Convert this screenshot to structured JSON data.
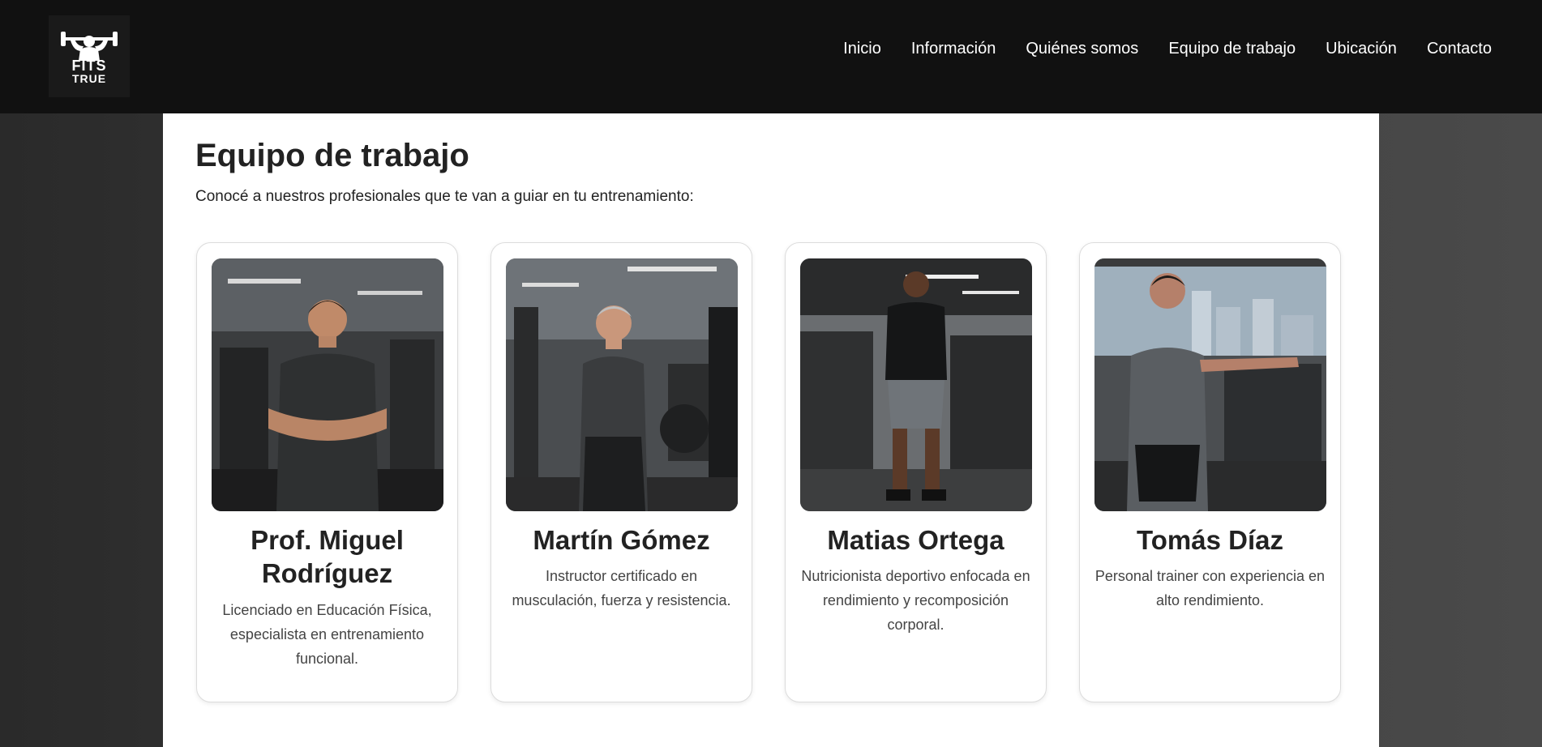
{
  "brand": {
    "line1": "FITS",
    "line2": "TRUE",
    "icon": "bodybuilder-dumbbell-logo"
  },
  "nav": [
    "Inicio",
    "Información",
    "Quiénes somos",
    "Equipo de trabajo",
    "Ubicación",
    "Contacto"
  ],
  "page": {
    "title": "Equipo de trabajo",
    "intro": "Conocé a nuestros profesionales que te van a guiar en tu entrenamiento:"
  },
  "team": [
    {
      "name": "Prof. Miguel Rodríguez",
      "description": "Licenciado en Educación Física, especialista en entrenamiento funcional."
    },
    {
      "name": "Martín Gómez",
      "description": "Instructor certificado en musculación, fuerza y resistencia."
    },
    {
      "name": "Matias Ortega",
      "description": "Nutricionista deportivo enfocada en rendimiento y recomposición corporal."
    },
    {
      "name": "Tomás Díaz",
      "description": "Personal trainer con experiencia en alto rendimiento."
    }
  ],
  "colors": {
    "navbar": "#111111",
    "background": "#3a3a3a",
    "card_border": "#dcdcdc"
  }
}
